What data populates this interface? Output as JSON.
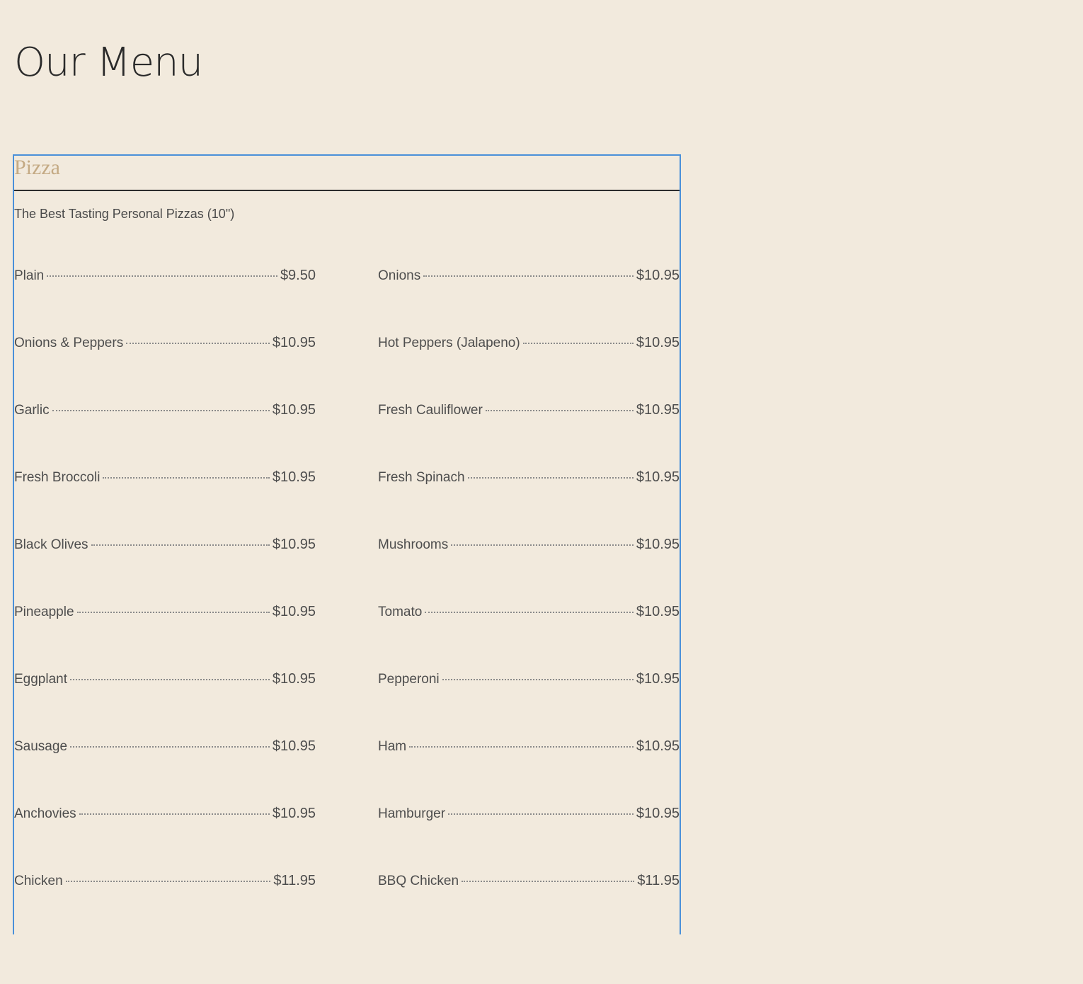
{
  "page": {
    "title": "Our Menu"
  },
  "section": {
    "title": "Pizza",
    "subtitle": "The Best Tasting Personal Pizzas (10\")",
    "accent_color": "#c4aa84",
    "frame_color": "#4a90d9",
    "background_color": "#f2eadd"
  },
  "left_items": [
    {
      "name": "Plain",
      "price": "$9.50"
    },
    {
      "name": "Onions & Peppers",
      "price": "$10.95"
    },
    {
      "name": "Garlic",
      "price": "$10.95"
    },
    {
      "name": "Fresh Broccoli",
      "price": "$10.95"
    },
    {
      "name": "Black Olives",
      "price": "$10.95"
    },
    {
      "name": "Pineapple",
      "price": "$10.95"
    },
    {
      "name": "Eggplant",
      "price": "$10.95"
    },
    {
      "name": "Sausage",
      "price": "$10.95"
    },
    {
      "name": "Anchovies",
      "price": "$10.95"
    },
    {
      "name": "Chicken",
      "price": "$11.95"
    }
  ],
  "right_items": [
    {
      "name": "Onions",
      "price": "$10.95"
    },
    {
      "name": "Hot Peppers (Jalapeno)",
      "price": "$10.95"
    },
    {
      "name": "Fresh Cauliflower",
      "price": "$10.95"
    },
    {
      "name": "Fresh Spinach",
      "price": "$10.95"
    },
    {
      "name": "Mushrooms",
      "price": "$10.95"
    },
    {
      "name": "Tomato",
      "price": "$10.95"
    },
    {
      "name": "Pepperoni",
      "price": "$10.95"
    },
    {
      "name": "Ham",
      "price": "$10.95"
    },
    {
      "name": "Hamburger",
      "price": "$10.95"
    },
    {
      "name": "BBQ Chicken",
      "price": "$11.95"
    }
  ]
}
